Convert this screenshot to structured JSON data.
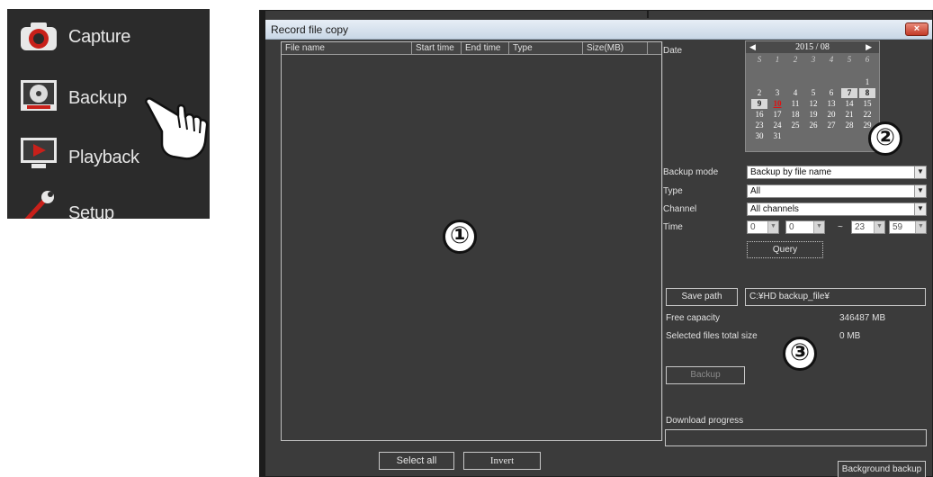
{
  "menu": {
    "items": [
      {
        "label": "Capture",
        "icon": "capture-icon"
      },
      {
        "label": "Backup",
        "icon": "backup-icon"
      },
      {
        "label": "Playback",
        "icon": "playback-icon"
      },
      {
        "label": "Setup",
        "icon": "setup-icon"
      }
    ],
    "cursor_icon": "pointing-hand-icon"
  },
  "dialog": {
    "title": "Record file copy",
    "close_label": "×",
    "table": {
      "columns": [
        "File name",
        "Start time",
        "End time",
        "Type",
        "Size(MB)"
      ],
      "rows": []
    },
    "select_all_label": "Select all",
    "invert_label": "Invert",
    "date_label": "Date",
    "calendar": {
      "title": "2015 / 08",
      "prev": "◀",
      "next": "▶",
      "weekdays": [
        "S",
        "1",
        "2",
        "3",
        "4",
        "5",
        "6"
      ],
      "weeks": [
        [
          "",
          "",
          "",
          "",
          "",
          "",
          "1"
        ],
        [
          "2",
          "3",
          "4",
          "5",
          "6",
          "7",
          "8"
        ],
        [
          "9",
          "10",
          "11",
          "12",
          "13",
          "14",
          "15"
        ],
        [
          "16",
          "17",
          "18",
          "19",
          "20",
          "21",
          "22"
        ],
        [
          "23",
          "24",
          "25",
          "26",
          "27",
          "28",
          "29"
        ],
        [
          "30",
          "31",
          "",
          "",
          "",
          "",
          ""
        ]
      ],
      "highlighted_days": [
        "7",
        "8",
        "9"
      ],
      "today": "10"
    },
    "backup_mode": {
      "label": "Backup mode",
      "value": "Backup by file name"
    },
    "type": {
      "label": "Type",
      "value": "All"
    },
    "channel": {
      "label": "Channel",
      "value": "All channels"
    },
    "time": {
      "label": "Time",
      "from_hour": "0",
      "from_min": "0",
      "separator": "~",
      "to_hour": "23",
      "to_min": "59"
    },
    "query_label": "Query",
    "save_path_label": "Save path",
    "save_path_value": "C:¥HD backup_file¥",
    "free_capacity": {
      "label": "Free capacity",
      "value": "346487 MB"
    },
    "selected_total": {
      "label": "Selected files total size",
      "value": "0 MB"
    },
    "backup_label": "Backup",
    "download_progress": {
      "label": "Download progress",
      "value": 0
    },
    "background_backup_label": "Background backup"
  },
  "markers": [
    "①",
    "②",
    "③"
  ],
  "colors": {
    "dialog_bg": "#3b3b3b",
    "menu_bg": "#2b2b2b",
    "title_gradient": "#c9d7e6",
    "close_red": "#c33b27",
    "calendar_bg": "#6b6b6b",
    "today_red": "#e01010"
  }
}
